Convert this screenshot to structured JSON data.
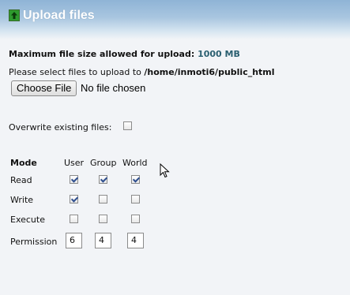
{
  "header": {
    "title": "Upload files",
    "icon": "upload-arrow-icon"
  },
  "max_size": {
    "label": "Maximum file size allowed for upload:",
    "value": "1000 MB"
  },
  "select": {
    "prompt": "Please select files to upload to",
    "path": "/home/inmoti6/public_html"
  },
  "file_input": {
    "button_label": "Choose File",
    "status": "No file chosen"
  },
  "overwrite": {
    "label": "Overwrite existing files:",
    "checked": false
  },
  "permissions": {
    "mode_header": "Mode",
    "columns": [
      "User",
      "Group",
      "World"
    ],
    "rows": [
      {
        "label": "Read",
        "values": [
          true,
          true,
          true
        ]
      },
      {
        "label": "Write",
        "values": [
          true,
          false,
          false
        ]
      },
      {
        "label": "Execute",
        "values": [
          false,
          false,
          false
        ]
      }
    ],
    "permission_label": "Permission",
    "permission_values": [
      "6",
      "4",
      "4"
    ]
  }
}
